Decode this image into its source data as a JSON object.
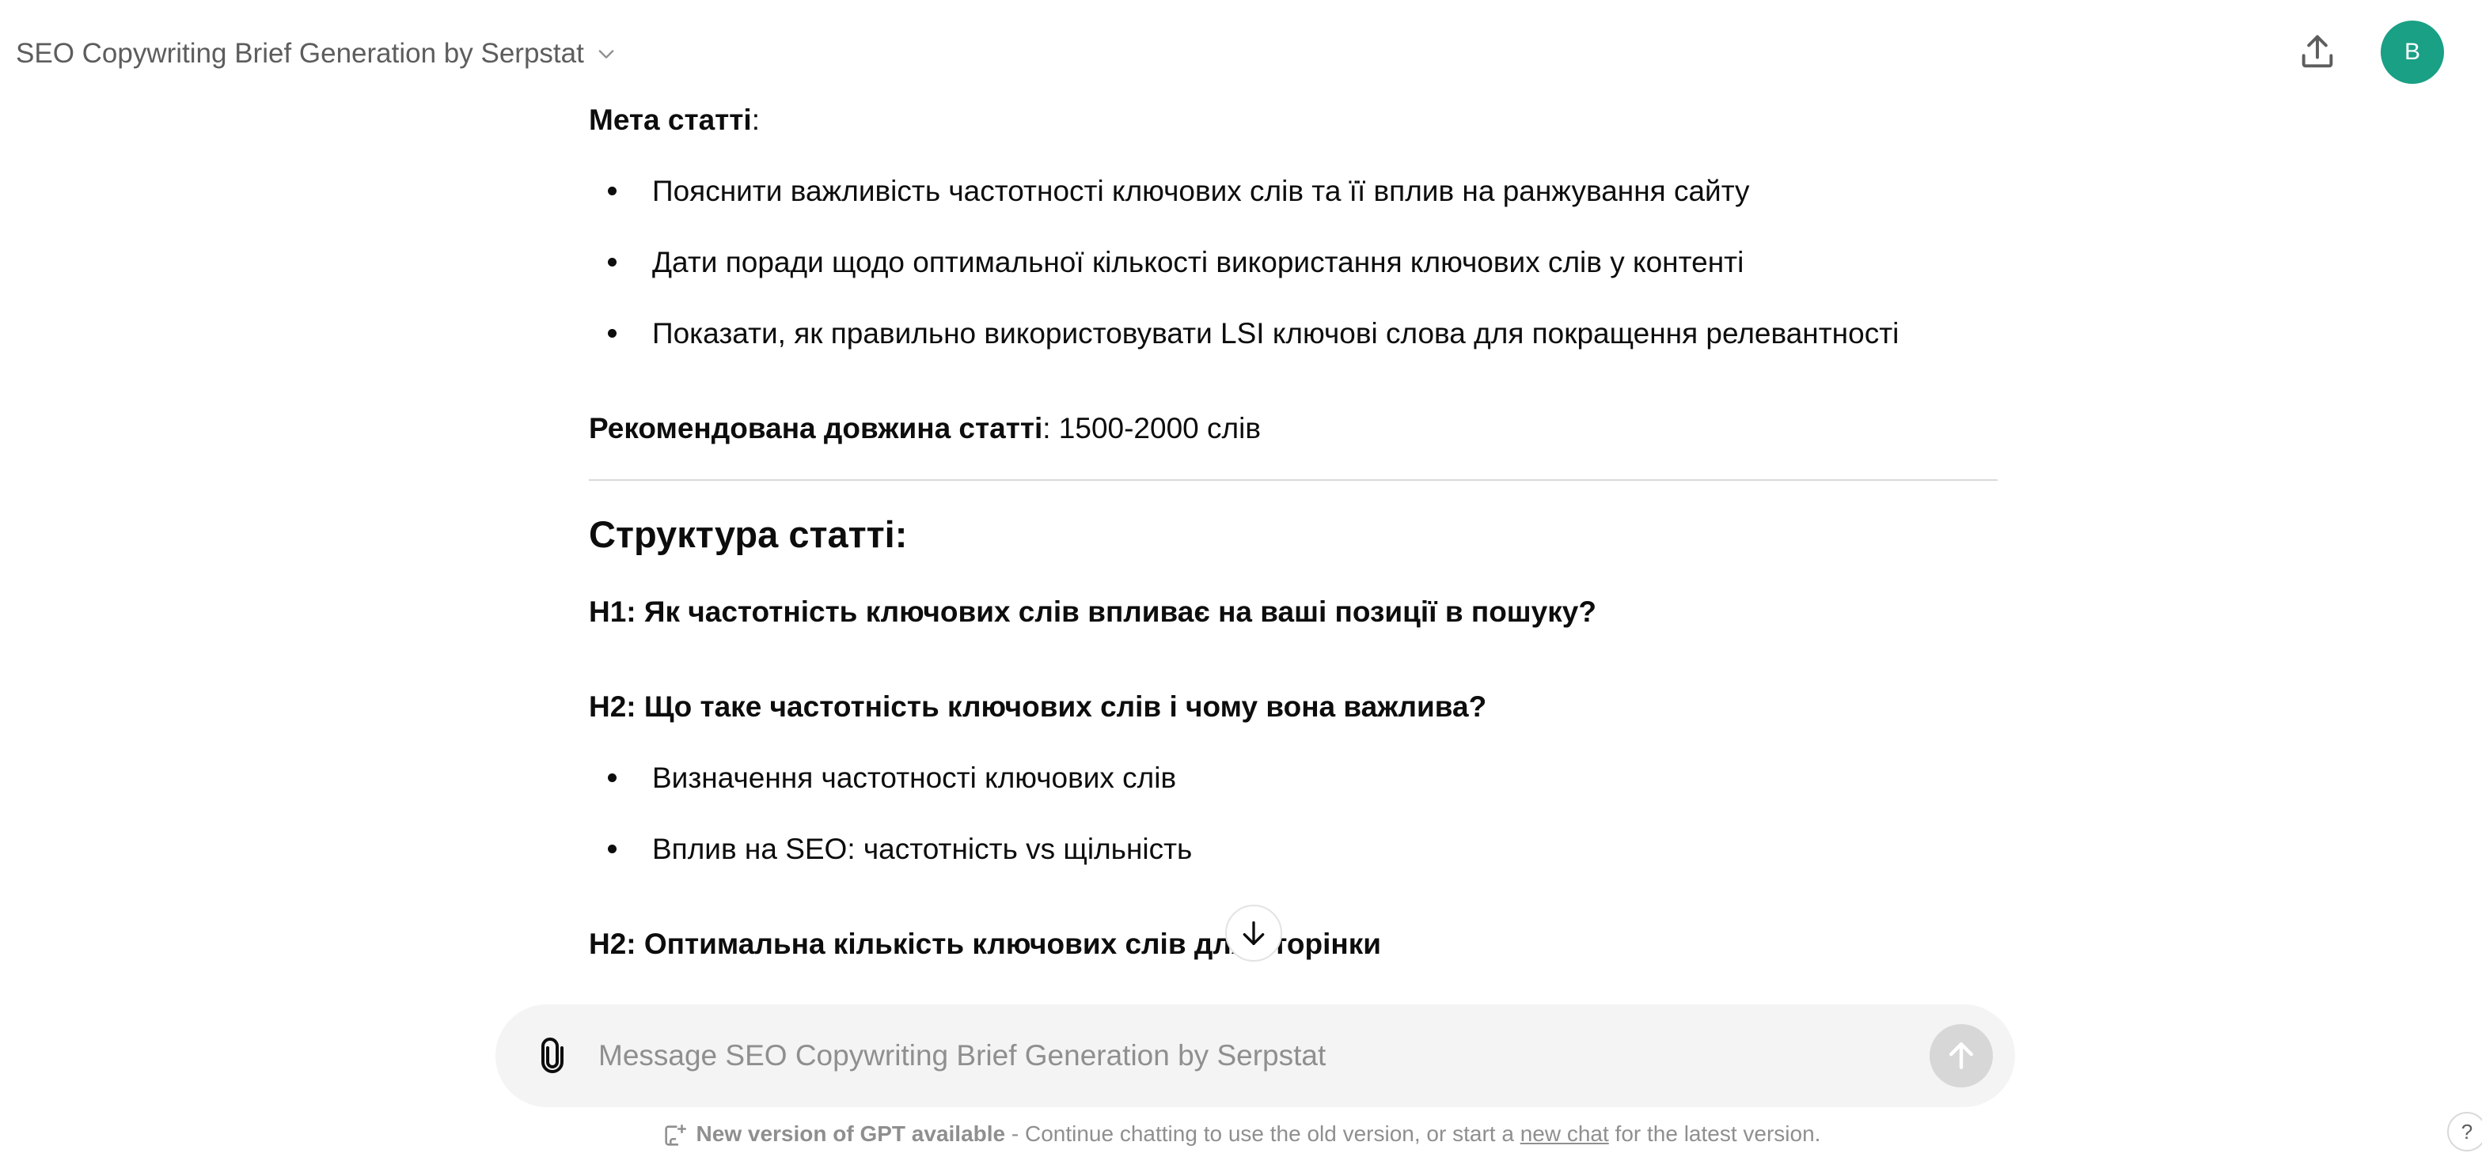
{
  "header": {
    "model_title": "SEO Copywriting Brief Generation by Serpstat",
    "avatar_letter": "B"
  },
  "content": {
    "goal_label": "Мета статті",
    "goal_colon": ":",
    "goal_items": [
      "Пояснити важливість частотності ключових слів та її вплив на ранжування сайту",
      "Дати поради щодо оптимальної кількості використання ключових слів у контенті",
      "Показати, як правильно використовувати LSI ключові слова для покращення релевантності"
    ],
    "length_label": "Рекомендована довжина статті",
    "length_value": ": 1500-2000 слів",
    "structure_heading": "Структура статті:",
    "h1_line": "H1: Як частотність ключових слів впливає на ваші позиції в пошуку?",
    "h2_first": "H2: Що таке частотність ключових слів і чому вона важлива?",
    "h2_first_items": [
      "Визначення частотності ключових слів",
      "Вплив на SEO: частотність vs щільність"
    ],
    "h2_second": "H2: Оптимальна кількість ключових слів для сторінки"
  },
  "composer": {
    "placeholder": "Message SEO Copywriting Brief Generation by Serpstat"
  },
  "footer": {
    "new_version": "New version of GPT available",
    "text_before_link": " - Continue chatting to use the old version, or start a ",
    "link_text": "new chat",
    "text_after_link": " for the latest version."
  },
  "help_label": "?",
  "icons": {
    "model_menu": "chevron-down-icon",
    "share": "share-upload-icon",
    "scroll_down": "arrow-down-icon",
    "attach": "paperclip-icon",
    "send": "arrow-up-icon",
    "new_version": "new-version-icon"
  },
  "colors": {
    "avatar_bg": "#19a085",
    "composer_bg": "#f4f4f4",
    "send_disabled_bg": "#d7d7d7",
    "muted_text": "#8f8f8f"
  }
}
